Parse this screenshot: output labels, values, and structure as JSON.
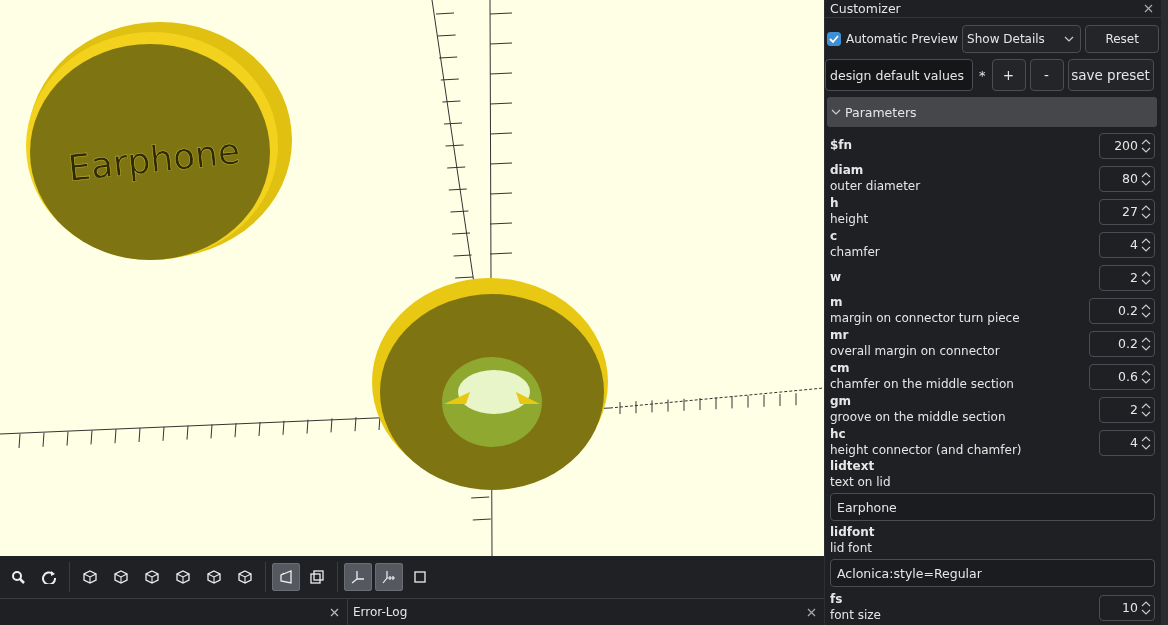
{
  "viewport": {
    "lid_text": "Earphone"
  },
  "toolbar": [
    {
      "kind": "zoom",
      "on": false
    },
    {
      "kind": "reset",
      "on": false
    },
    {
      "kind": "sep"
    },
    {
      "kind": "cube",
      "on": false
    },
    {
      "kind": "cube",
      "on": false
    },
    {
      "kind": "cube",
      "on": false
    },
    {
      "kind": "cube",
      "on": false
    },
    {
      "kind": "cube",
      "on": false
    },
    {
      "kind": "cube",
      "on": false
    },
    {
      "kind": "sep"
    },
    {
      "kind": "perspective",
      "on": true
    },
    {
      "kind": "ortho",
      "on": false
    },
    {
      "kind": "sep"
    },
    {
      "kind": "axes",
      "on": true
    },
    {
      "kind": "scale",
      "on": true
    },
    {
      "kind": "frame",
      "on": false
    }
  ],
  "bottom_tabs": [
    {
      "label": "Error-Log"
    }
  ],
  "customizer": {
    "title": "Customizer",
    "automatic_preview": {
      "label": "Automatic Preview",
      "checked": true
    },
    "details_select": "Show Details",
    "reset_button": "Reset",
    "preset_select": "design default values",
    "modified_mark": "*",
    "add_button": "+",
    "remove_button": "-",
    "save_button": "save preset",
    "section": {
      "title": "Parameters",
      "expanded": true
    },
    "parameters": [
      {
        "kind": "number",
        "name": "$fn",
        "value": "200"
      },
      {
        "kind": "number",
        "name": "diam",
        "description": "outer diameter",
        "value": "80"
      },
      {
        "kind": "number",
        "name": "h",
        "description": "height",
        "value": "27"
      },
      {
        "kind": "number",
        "name": "c",
        "description": "chamfer",
        "value": "4"
      },
      {
        "kind": "number",
        "name": "w",
        "value": "2"
      },
      {
        "kind": "number",
        "name": "m",
        "description": "margin on connector turn piece",
        "value": "0.2"
      },
      {
        "kind": "number",
        "name": "mr",
        "description": "overall margin on connector",
        "value": "0.2"
      },
      {
        "kind": "number",
        "name": "cm",
        "description": "chamfer on the middle section",
        "value": "0.6"
      },
      {
        "kind": "number",
        "name": "gm",
        "description": "groove on the middle section",
        "value": "2"
      },
      {
        "kind": "number",
        "name": "hc",
        "description": "height connector (and chamfer)",
        "value": "4"
      },
      {
        "kind": "text",
        "name": "lidtext",
        "description": "text on lid",
        "value": "Earphone"
      },
      {
        "kind": "text",
        "name": "lidfont",
        "description": "lid font",
        "value": "Aclonica:style=Regular"
      },
      {
        "kind": "number",
        "name": "fs",
        "description": "font size",
        "value": "10"
      }
    ]
  }
}
